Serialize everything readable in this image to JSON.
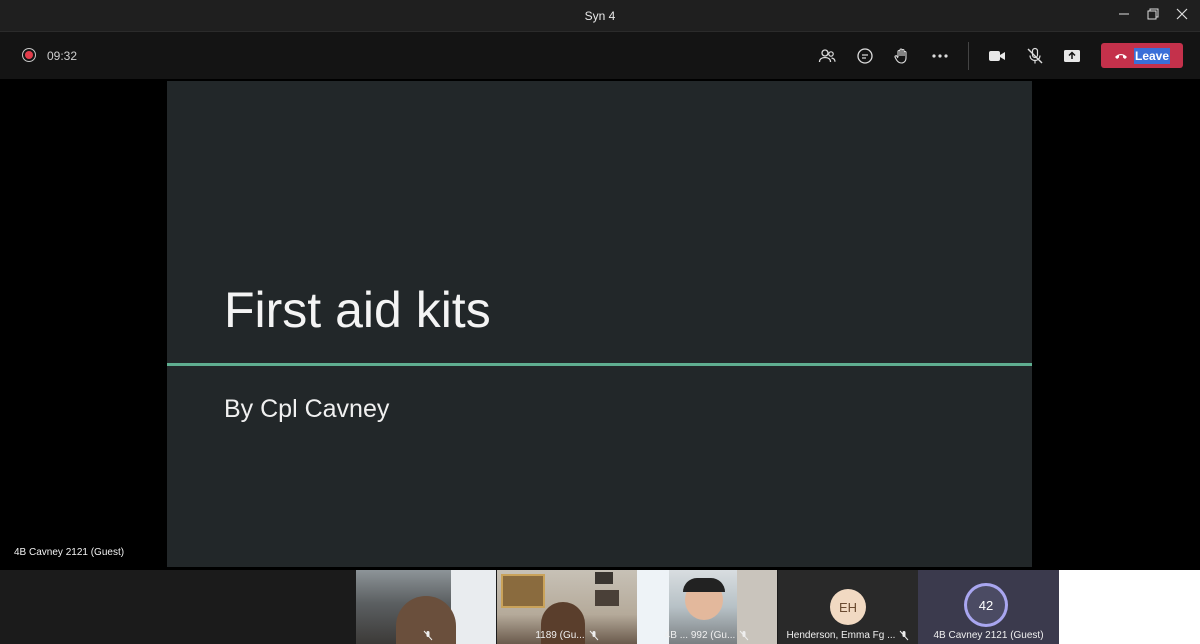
{
  "window": {
    "title": "Syn 4"
  },
  "toolbar": {
    "timer": "09:32",
    "leave_label": "Leave"
  },
  "icons": {
    "participants": "people-icon",
    "chat": "chat-icon",
    "reactions": "raise-hand-icon",
    "more": "more-icon",
    "camera": "camera-icon",
    "mic": "mic-off-icon",
    "share": "share-screen-icon",
    "leave": "phone-hangup-icon"
  },
  "slide": {
    "title": "First aid kits",
    "subtitle": "By Cpl Cavney"
  },
  "stage": {
    "presenter_label": "4B Cavney 2121 (Guest)"
  },
  "gallery": {
    "tiles": [
      {
        "caption": ""
      },
      {
        "caption": "1189 (Gu..."
      },
      {
        "caption": "4B ... 992 (Gu..."
      },
      {
        "caption": "Henderson, Emma Fg ...",
        "initials": "EH"
      },
      {
        "caption": "4B Cavney 2121 (Guest)",
        "initials": "42"
      }
    ]
  },
  "colors": {
    "leave": "#c4314b",
    "slide_bg": "#222729",
    "slide_accent": "#5fae90",
    "record": "#e23c4b"
  }
}
